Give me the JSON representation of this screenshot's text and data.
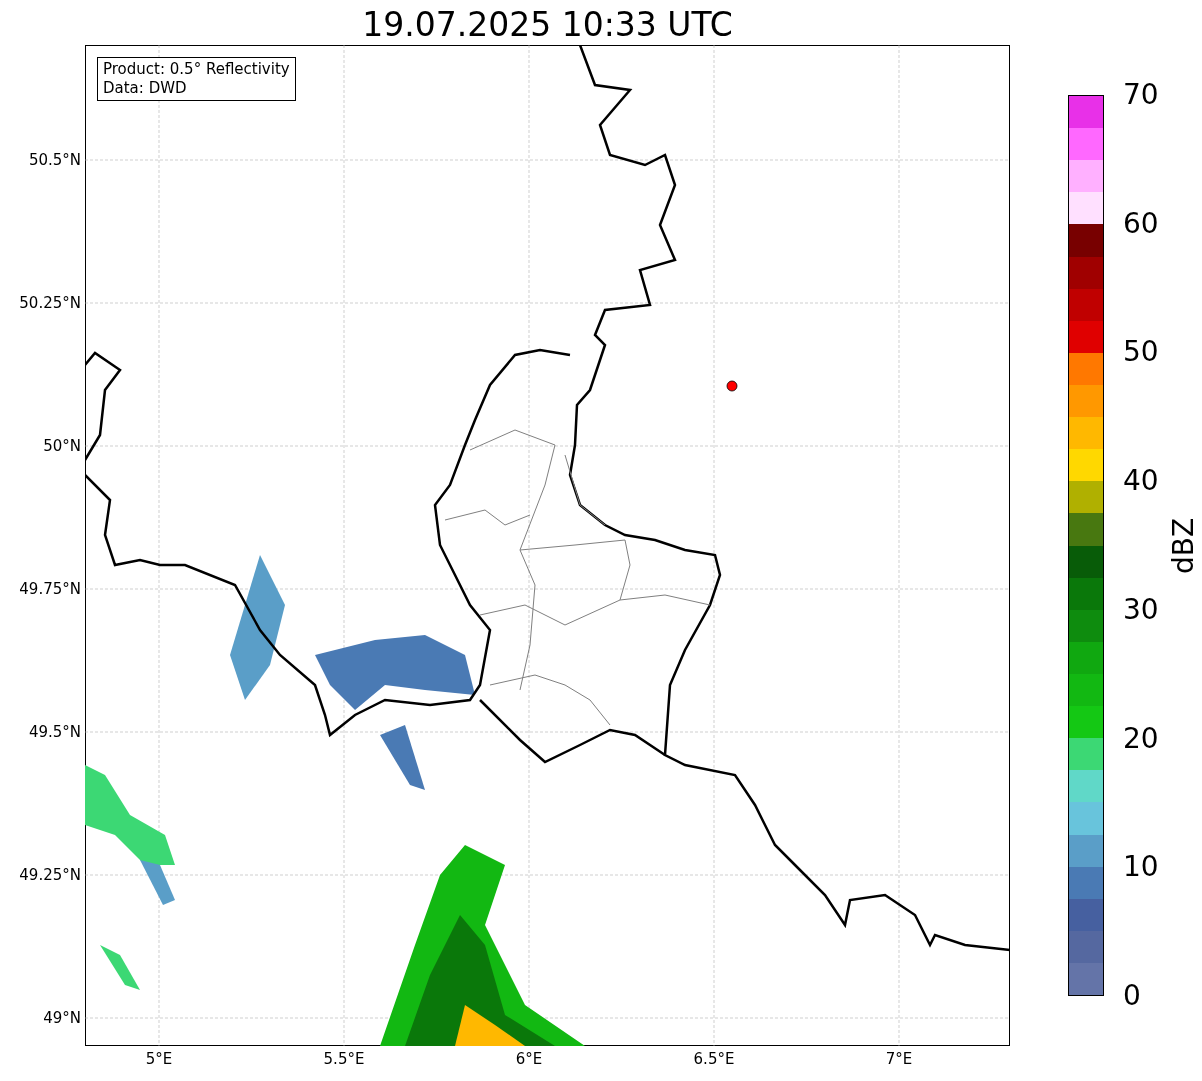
{
  "title": "19.07.2025 10:33 UTC",
  "info_box": [
    "Product: 0.5° Reflectivity",
    "Data: DWD"
  ],
  "map": {
    "x_ticks": [
      "5°E",
      "5.5°E",
      "6°E",
      "6.5°E",
      "7°E"
    ],
    "y_ticks": [
      "50.5°N",
      "50.25°N",
      "50°N",
      "49.75°N",
      "49.5°N",
      "49.25°N",
      "49°N"
    ]
  },
  "colorbar": {
    "label": "dBZ",
    "ticks": [
      "70",
      "60",
      "50",
      "40",
      "30",
      "20",
      "10",
      "0"
    ],
    "segments": [
      {
        "color": "#e830e8"
      },
      {
        "color": "#ff68ff"
      },
      {
        "color": "#ffb0ff"
      },
      {
        "color": "#ffe0ff"
      },
      {
        "color": "#780000"
      },
      {
        "color": "#a00000"
      },
      {
        "color": "#c00000"
      },
      {
        "color": "#e00000"
      },
      {
        "color": "#ff7800"
      },
      {
        "color": "#ff9800"
      },
      {
        "color": "#ffb800"
      },
      {
        "color": "#ffd800"
      },
      {
        "color": "#b0b000"
      },
      {
        "color": "#487810"
      },
      {
        "color": "#085c08"
      },
      {
        "color": "#0a780a"
      },
      {
        "color": "#0e8c0e"
      },
      {
        "color": "#10a810"
      },
      {
        "color": "#12b812"
      },
      {
        "color": "#14c814"
      },
      {
        "color": "#3cd874"
      },
      {
        "color": "#60d8c8"
      },
      {
        "color": "#68c4dc"
      },
      {
        "color": "#5a9ec8"
      },
      {
        "color": "#4a7ab4"
      },
      {
        "color": "#4660a0"
      },
      {
        "color": "#5568a0"
      },
      {
        "color": "#6474a8"
      }
    ]
  }
}
